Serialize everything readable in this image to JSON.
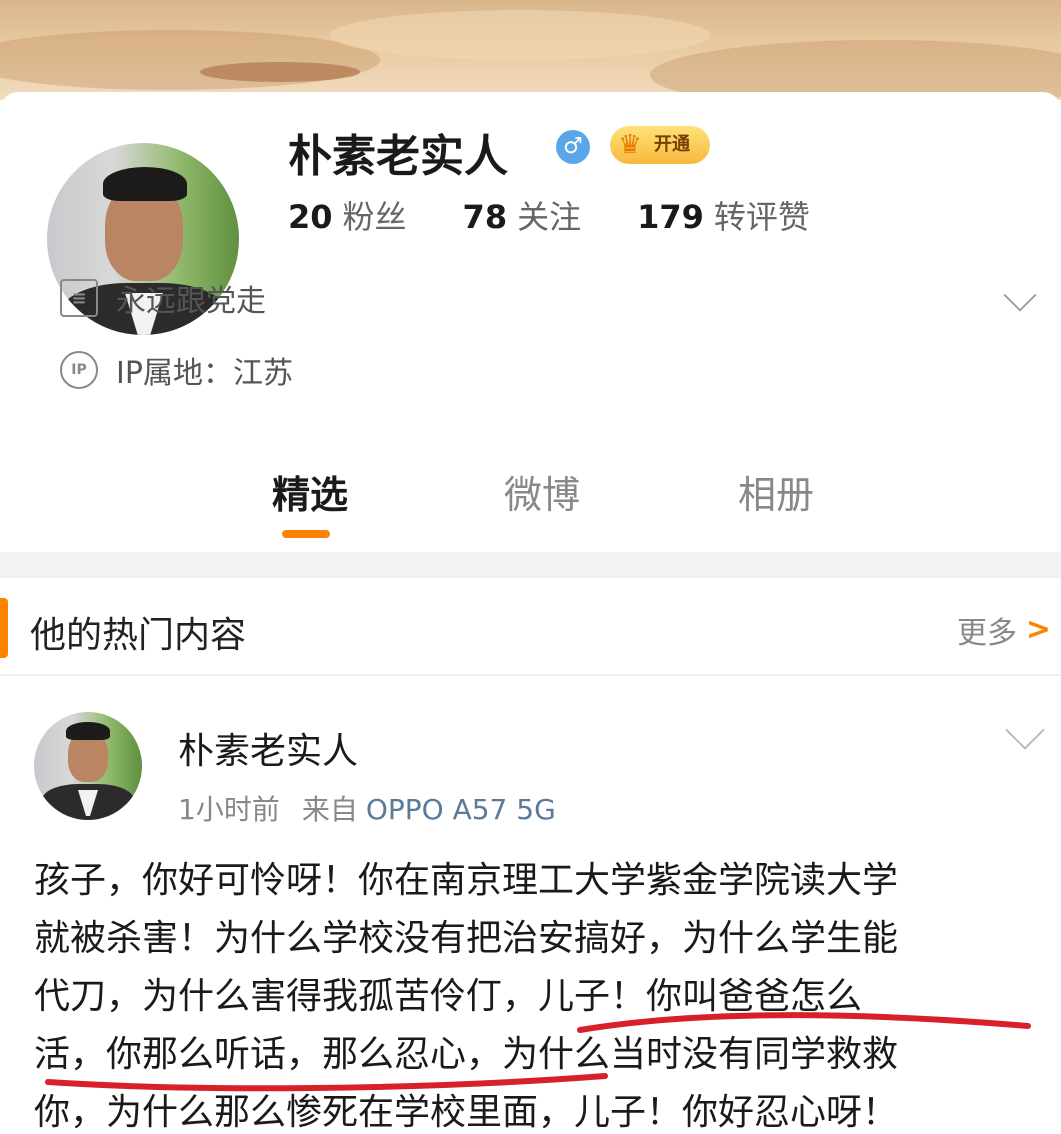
{
  "profile": {
    "name": "朴素老实人",
    "gender_icon": "male-icon",
    "vip_label": "开通",
    "stats": [
      {
        "num": "20",
        "label": "粉丝"
      },
      {
        "num": "78",
        "label": "关注"
      },
      {
        "num": "179",
        "label": "转评赞"
      }
    ],
    "bio": "永远跟党走",
    "ip": "IP属地：江苏",
    "ip_icon_label": "IP"
  },
  "tabs": [
    {
      "label": "精选",
      "active": true
    },
    {
      "label": "微博",
      "active": false
    },
    {
      "label": "相册",
      "active": false
    }
  ],
  "section": {
    "title": "他的热门内容",
    "more_label": "更多",
    "more_arrow": ">"
  },
  "post": {
    "author": "朴素老实人",
    "time": "1小时前",
    "source_prefix": "来自",
    "device": "OPPO A57 5G",
    "lines": [
      "孩子，你好可怜呀！你在南京理工大学紫金学院读大学",
      "就被杀害！为什么学校没有把治安搞好，为什么学生能",
      "代刀，为什么害得我孤苦伶仃，儿子！你叫爸爸怎么",
      "活，你那么听话，那么忍心，为什么当时没有同学救救",
      "你，为什么那么惨死在学校里面，儿子！你好忍心呀！"
    ]
  },
  "colors": {
    "accent": "#ff8200",
    "annotation_red": "#d8202a",
    "link_blue": "#5a7a99"
  }
}
